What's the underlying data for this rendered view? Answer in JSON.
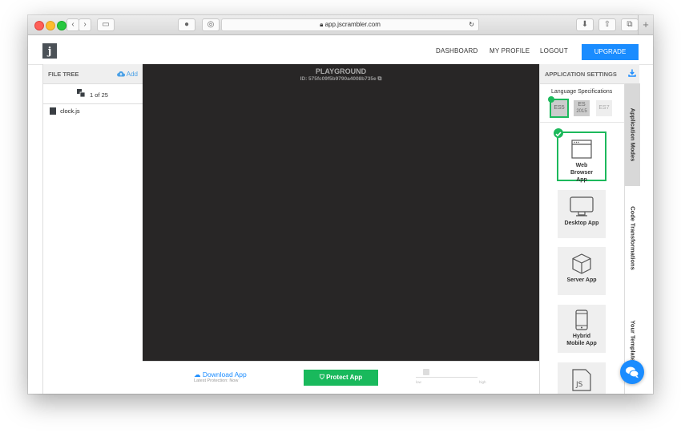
{
  "browser": {
    "url": "app.jscrambler.com",
    "plus_label": "+"
  },
  "header": {
    "logo_text": "j",
    "nav": [
      "DASHBOARD",
      "MY PROFILE",
      "LOGOUT"
    ],
    "upgrade_label": "UPGRADE"
  },
  "file_tree": {
    "title": "FILE TREE",
    "add_label": "Add",
    "pager_text": "1 of 25",
    "files": [
      "clock.js"
    ]
  },
  "playground": {
    "title": "PLAYGROUND",
    "id_text": "ID: 575fc09f5b9790a4008b735e"
  },
  "bottom": {
    "download_label": "Download App",
    "latest_protection": "Latest Protection: Now",
    "protect_label": "Protect App",
    "low_label": "low",
    "high_label": "high"
  },
  "settings": {
    "title": "APPLICATION SETTINGS",
    "language_label": "Language Specifications",
    "languages": [
      {
        "label": "ES5",
        "selected": true
      },
      {
        "label": "ES 2015",
        "line1": "ES",
        "line2": "2015",
        "selected": false
      },
      {
        "label": "ES7",
        "selected": false
      }
    ],
    "modes": [
      {
        "label": "Web Browser App",
        "lines": [
          "Web",
          "Browser",
          "App"
        ],
        "icon": "browser-window-icon",
        "selected": true
      },
      {
        "label": "Desktop App",
        "icon": "monitor-icon",
        "selected": false
      },
      {
        "label": "Server App",
        "icon": "cube-icon",
        "selected": false
      },
      {
        "label": "Hybrid Mobile App",
        "lines": [
          "Hybrid",
          "Mobile App"
        ],
        "icon": "smartphone-icon",
        "selected": false
      },
      {
        "label": "JS",
        "icon": "js-file-icon",
        "selected": false
      }
    ]
  },
  "vertical_tabs": [
    "Application Modes",
    "Code Transformations",
    "Your Templates"
  ],
  "colors": {
    "accent_blue": "#1a8cff",
    "success_green": "#19b95c",
    "editor_bg": "#282626"
  }
}
